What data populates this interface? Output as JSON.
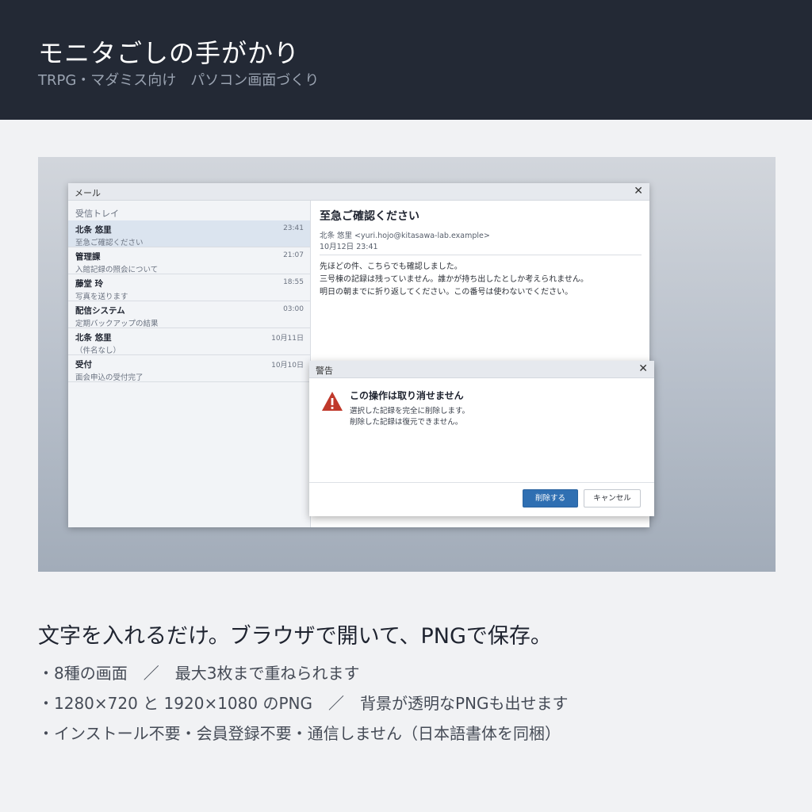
{
  "header": {
    "title": "モニタごしの手がかり",
    "subtitle": "TRPG・マダミス向け　パソコン画面づくり"
  },
  "mail_window": {
    "title": "メール",
    "close_glyph": "✕",
    "list_header": "受信トレイ",
    "items": [
      {
        "from": "北条 悠里",
        "subject": "至急ご確認ください",
        "time": "23:41"
      },
      {
        "from": "管理課",
        "subject": "入館記録の照会について",
        "time": "21:07"
      },
      {
        "from": "藤堂 玲",
        "subject": "写真を送ります",
        "time": "18:55"
      },
      {
        "from": "配信システム",
        "subject": "定期バックアップの結果",
        "time": "03:00"
      },
      {
        "from": "北条 悠里",
        "subject": "（件名なし）",
        "time": "10月11日"
      },
      {
        "from": "受付",
        "subject": "面会申込の受付完了",
        "time": "10月10日"
      }
    ],
    "reading": {
      "subject": "至急ご確認ください",
      "sender": "北条 悠里 <yuri.hojo@kitasawa-lab.example>",
      "date": "10月12日 23:41",
      "lines": [
        "先ほどの件、こちらでも確認しました。",
        "三号棟の記録は残っていません。誰かが持ち出したとしか考えられません。",
        "明日の朝までに折り返してください。この番号は使わないでください。"
      ]
    }
  },
  "dialog": {
    "title": "警告",
    "close_glyph": "✕",
    "icon": "warning-icon",
    "heading": "この操作は取り消せません",
    "lines": [
      "選択した記録を完全に削除します。",
      "削除した記録は復元できません。"
    ],
    "primary_label": "削除する",
    "secondary_label": "キャンセル"
  },
  "headline": "文字を入れるだけ。ブラウザで開いて、PNGで保存。",
  "bullets": [
    "・8種の画面　／　最大3枚まで重ねられます",
    "・1280×720 と 1920×1080 のPNG　／　背景が透明なPNGも出せます",
    "・インストール不要・会員登録不要・通信しません（日本語書体を同梱）"
  ],
  "colors": {
    "header_bg": "#232935",
    "primary_button": "#2f6fb2",
    "warning": "#c0392b",
    "selected_row": "#dbe4ef"
  }
}
